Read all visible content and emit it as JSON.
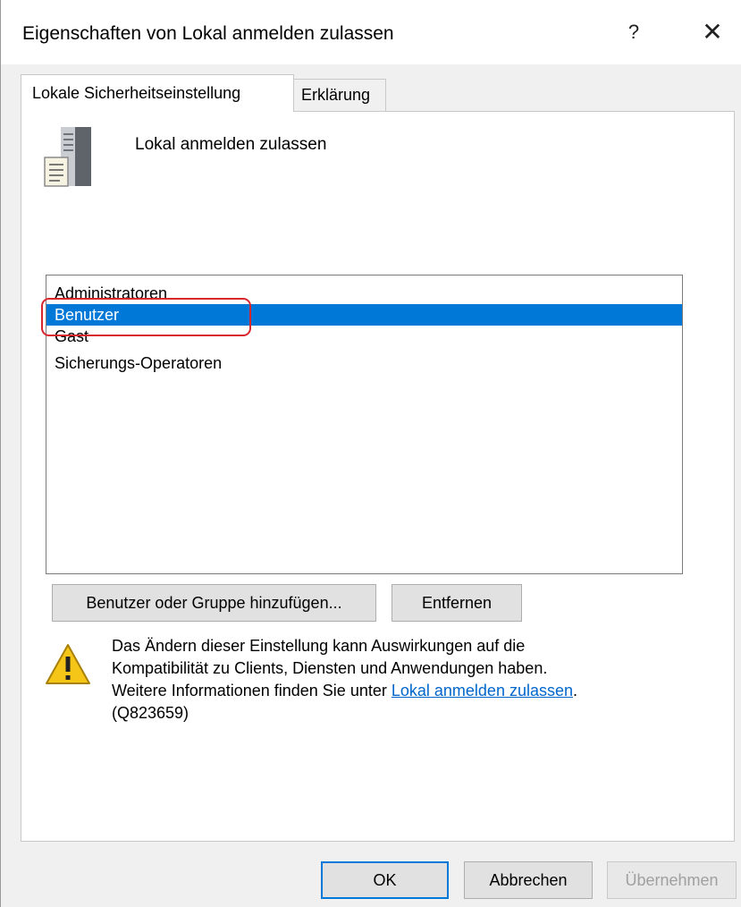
{
  "window": {
    "title": "Eigenschaften von Lokal anmelden zulassen",
    "help_symbol": "?",
    "close_symbol": "✕"
  },
  "tabs": [
    {
      "label": "Lokale Sicherheitseinstellung",
      "active": true
    },
    {
      "label": "Erklärung",
      "active": false
    }
  ],
  "policy": {
    "name": "Lokal anmelden zulassen",
    "icon": "server-policy-icon"
  },
  "members": {
    "items": [
      {
        "label": "Administratoren",
        "selected": false
      },
      {
        "label": "Benutzer",
        "selected": true
      },
      {
        "label": "Gast",
        "selected": false
      },
      {
        "label": "Sicherungs-Operatoren",
        "selected": false
      }
    ]
  },
  "annotation": {
    "color": "#d8262d",
    "target": "Benutzer"
  },
  "actions": {
    "add_label": "Benutzer oder Gruppe hinzufügen...",
    "remove_label": "Entfernen"
  },
  "warning": {
    "icon": "warning-icon",
    "line1": "Das Ändern dieser Einstellung kann Auswirkungen auf die",
    "line2": "Kompatibilität zu Clients, Diensten und Anwendungen haben.",
    "line3_prefix": "Weitere Informationen finden Sie unter ",
    "link_text": "Lokal anmelden zulassen",
    "line3_suffix": ".",
    "line4": "(Q823659)"
  },
  "footer": {
    "ok_label": "OK",
    "cancel_label": "Abbrechen",
    "apply_label": "Übernehmen",
    "apply_enabled": false
  },
  "colors": {
    "selection": "#0078d7",
    "link": "#0066cc",
    "default_button_border": "#0078d7"
  }
}
